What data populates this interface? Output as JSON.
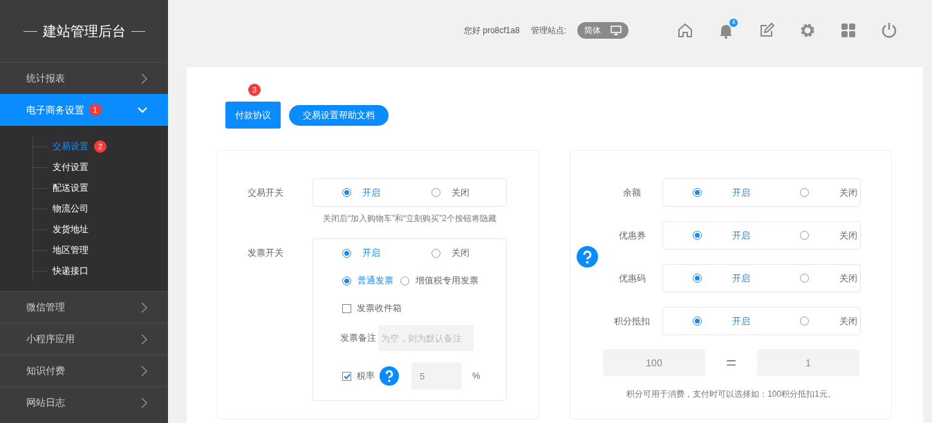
{
  "sidebar": {
    "title": "建站管理后台",
    "items": [
      {
        "label": "统计报表",
        "selected": false,
        "expanded": false
      },
      {
        "label": "电子商务设置",
        "selected": true,
        "expanded": true,
        "badge": "1",
        "children": [
          {
            "label": "交易设置",
            "selected": true,
            "badge": "2"
          },
          {
            "label": "支付设置",
            "selected": false
          },
          {
            "label": "配送设置",
            "selected": false
          },
          {
            "label": "物流公司",
            "selected": false
          },
          {
            "label": "发货地址",
            "selected": false
          },
          {
            "label": "地区管理",
            "selected": false
          },
          {
            "label": "快递接口",
            "selected": false
          }
        ]
      },
      {
        "label": "微信管理",
        "selected": false,
        "expanded": false
      },
      {
        "label": "小程序应用",
        "selected": false,
        "expanded": false
      },
      {
        "label": "知识付费",
        "selected": false,
        "expanded": false
      },
      {
        "label": "网站日志",
        "selected": false,
        "expanded": false
      }
    ]
  },
  "header": {
    "greeting": "您好 pro8cf1a8",
    "site_label": "管理站点:",
    "language": "简体",
    "notification_count": "4"
  },
  "buttons": [
    {
      "label": "付款协议",
      "kind": "square",
      "badge": "3"
    },
    {
      "label": "交易设置帮助文档",
      "kind": "pill"
    }
  ],
  "left_panel": {
    "trade_switch": {
      "label": "交易开关",
      "options": [
        {
          "label": "开启",
          "selected": true
        },
        {
          "label": "关闭",
          "selected": false
        }
      ],
      "note": "关闭后“加入购物车”和“立刻购买”2个按钮将隐藏"
    },
    "invoice": {
      "label": "发票开关",
      "options": [
        {
          "label": "开启",
          "selected": true
        },
        {
          "label": "关闭",
          "selected": false
        }
      ],
      "types": [
        {
          "label": "普通发票",
          "selected": true
        },
        {
          "label": "增值税专用发票",
          "selected": false
        }
      ],
      "inbox": {
        "label": "发票收件箱",
        "checked": false
      },
      "remark": {
        "label": "发票备注",
        "placeholder": "为空，则为默认备注"
      },
      "tax": {
        "label": "税率",
        "checked": true,
        "value": "5",
        "unit": "%"
      }
    }
  },
  "right_panel": {
    "rows": [
      {
        "label": "余额",
        "options": [
          {
            "label": "开启",
            "selected": true
          },
          {
            "label": "关闭",
            "selected": false
          }
        ]
      },
      {
        "label": "优惠券",
        "options": [
          {
            "label": "开启",
            "selected": true
          },
          {
            "label": "关闭",
            "selected": false
          }
        ]
      },
      {
        "label": "优惠码",
        "options": [
          {
            "label": "开启",
            "selected": true
          },
          {
            "label": "关闭",
            "selected": false
          }
        ]
      },
      {
        "label": "积分抵扣",
        "options": [
          {
            "label": "开启",
            "selected": true
          },
          {
            "label": "关闭",
            "selected": false
          }
        ]
      }
    ],
    "points": {
      "points_value": "100",
      "equals": "=",
      "money_value": "1",
      "note": "积分可用于消费，支付时可以选择如：100积分抵扣1元。"
    }
  }
}
